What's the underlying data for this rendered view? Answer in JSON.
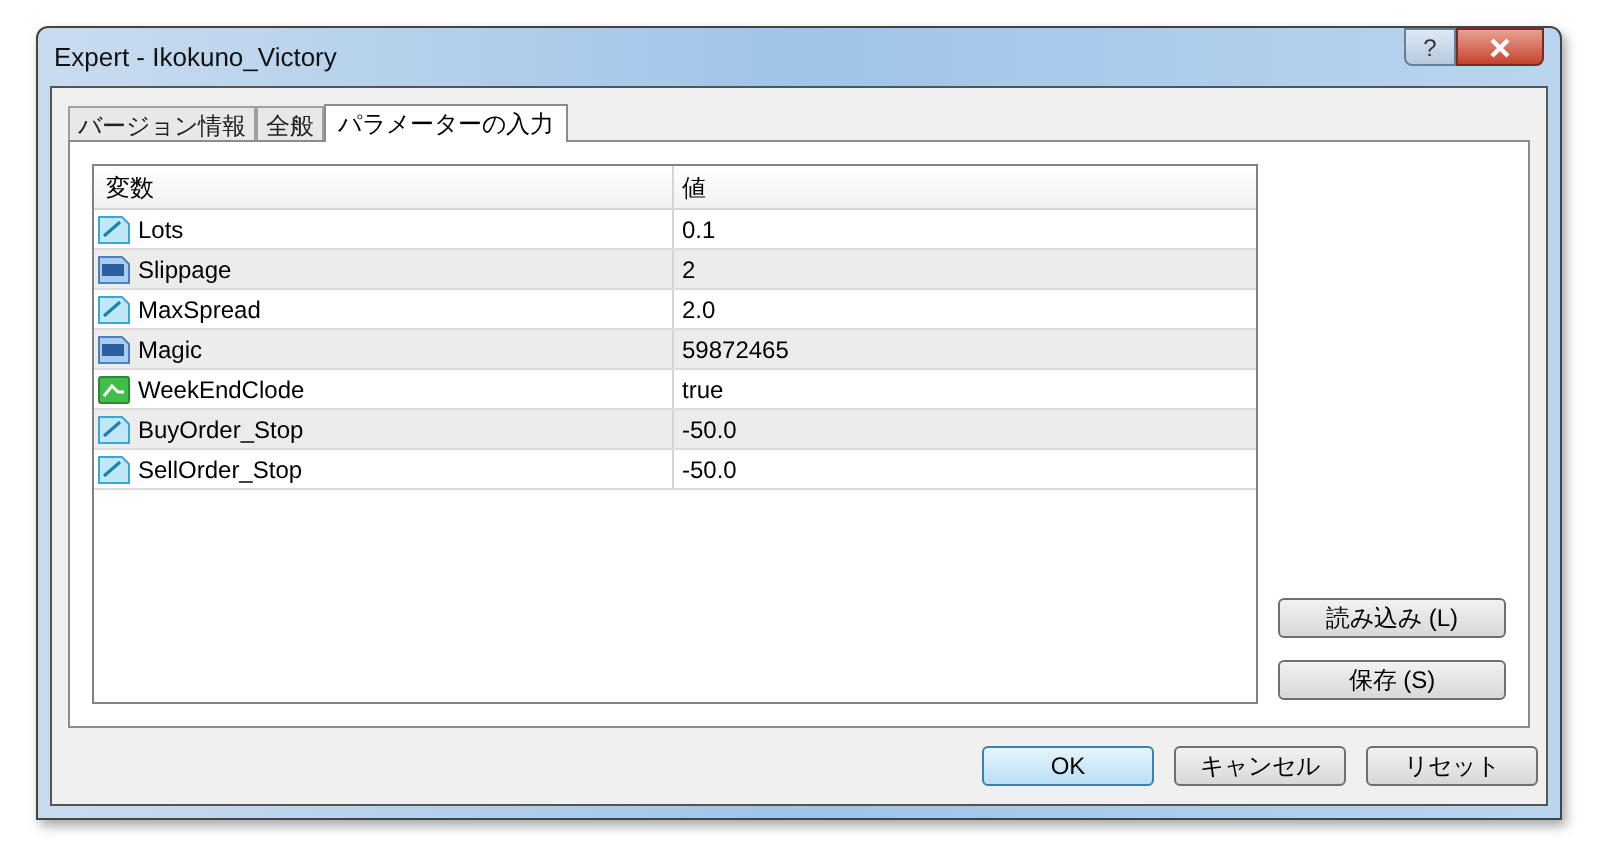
{
  "window": {
    "title": "Expert - Ikokuno_Victory"
  },
  "tabs": [
    {
      "label": "バージョン情報",
      "selected": false
    },
    {
      "label": "全般",
      "selected": false
    },
    {
      "label": "パラメーターの入力",
      "selected": true
    }
  ],
  "table": {
    "columns": [
      "変数",
      "値"
    ],
    "rows": [
      {
        "kind": "double",
        "name": "Lots",
        "value": "0.1"
      },
      {
        "kind": "integer",
        "name": "Slippage",
        "value": "2"
      },
      {
        "kind": "double",
        "name": "MaxSpread",
        "value": "2.0"
      },
      {
        "kind": "integer",
        "name": "Magic",
        "value": "59872465"
      },
      {
        "kind": "bool",
        "name": "WeekEndClode",
        "value": "true"
      },
      {
        "kind": "double",
        "name": "BuyOrder_Stop",
        "value": "-50.0"
      },
      {
        "kind": "double",
        "name": "SellOrder_Stop",
        "value": "-50.0"
      }
    ]
  },
  "side_buttons": [
    "読み込み (L)",
    "保存 (S)"
  ],
  "buttons": [
    {
      "label": "OK",
      "default": true
    },
    {
      "label": "キャンセル",
      "default": false
    },
    {
      "label": "リセット",
      "default": false
    }
  ],
  "title_buttons": [
    "?"
  ]
}
